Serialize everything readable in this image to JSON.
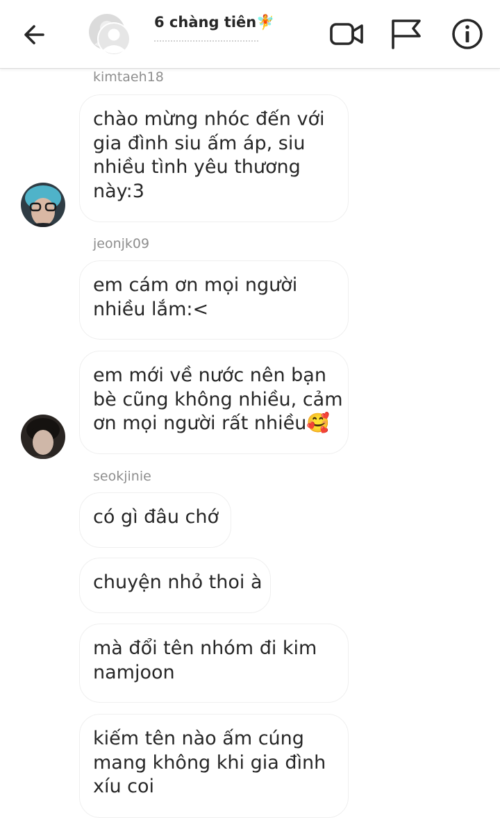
{
  "header": {
    "title": "6 chàng tiên🧚",
    "icons": [
      "back-arrow-icon",
      "group-avatar-icon",
      "video-camera-icon",
      "flag-icon",
      "info-icon"
    ]
  },
  "messages": [
    {
      "sender": "kimtaeh18",
      "lines": [
        "chào mừng nhóc đến với",
        "gia đình siu ấm áp, siu",
        "nhiều tình yêu thương",
        "này:3"
      ]
    },
    {
      "sender": "jeonjk09",
      "lines": [
        "em cám ơn mọi người",
        "nhiều lắm:<"
      ]
    },
    {
      "lines": [
        "em mới về nước nên bạn",
        "bè cũng không nhiều, cảm",
        "ơn mọi người rất nhiều🥰"
      ]
    },
    {
      "sender": "seokjinie",
      "lines": [
        "có gì đâu chớ"
      ]
    },
    {
      "lines": [
        "chuyện nhỏ thoi à"
      ]
    },
    {
      "lines": [
        "mà đổi tên nhóm đi kim",
        "namjoon"
      ]
    },
    {
      "lines": [
        "kiếm tên nào ấm cúng",
        "mang không khi gia đình",
        "xíu coi"
      ]
    }
  ],
  "colors": {
    "text": "#262626",
    "secondary_text": "#8e8e8e",
    "bubble_border": "#efefef",
    "header_border": "#dbdbdb"
  }
}
